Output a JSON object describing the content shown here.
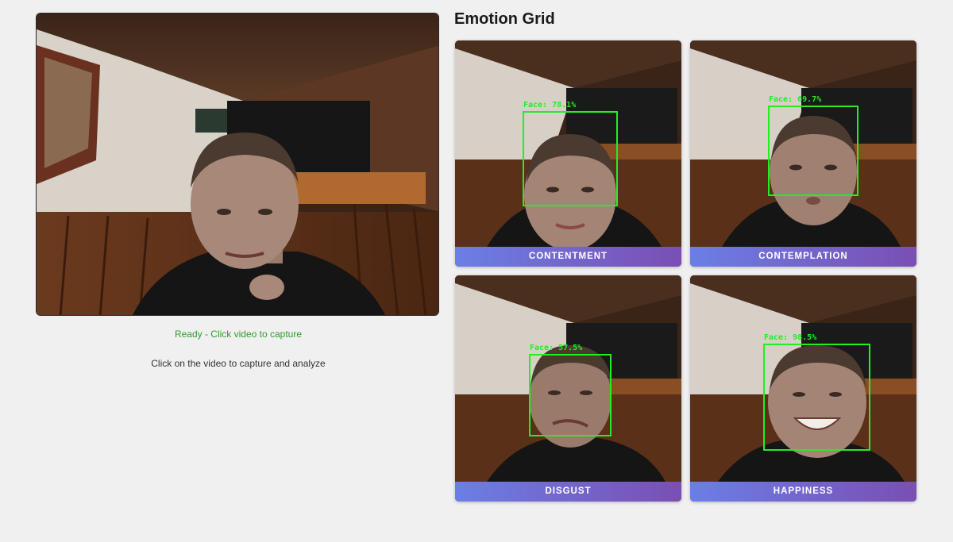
{
  "video": {
    "status": "Ready - Click video to capture",
    "instruction": "Click on the video to capture and analyze"
  },
  "grid": {
    "title": "Emotion Grid",
    "cards": [
      {
        "emotion": "CONTENTMENT",
        "face_label": "Face: 78.1%"
      },
      {
        "emotion": "CONTEMPLATION",
        "face_label": "Face: 69.7%"
      },
      {
        "emotion": "DISGUST",
        "face_label": "Face: 57.5%"
      },
      {
        "emotion": "HAPPINESS",
        "face_label": "Face: 98.5%"
      }
    ]
  },
  "colors": {
    "status_green": "#2e9b2e",
    "detection_box": "#22ee22",
    "label_gradient_start": "#6a7fe6",
    "label_gradient_end": "#7a4fb4"
  }
}
